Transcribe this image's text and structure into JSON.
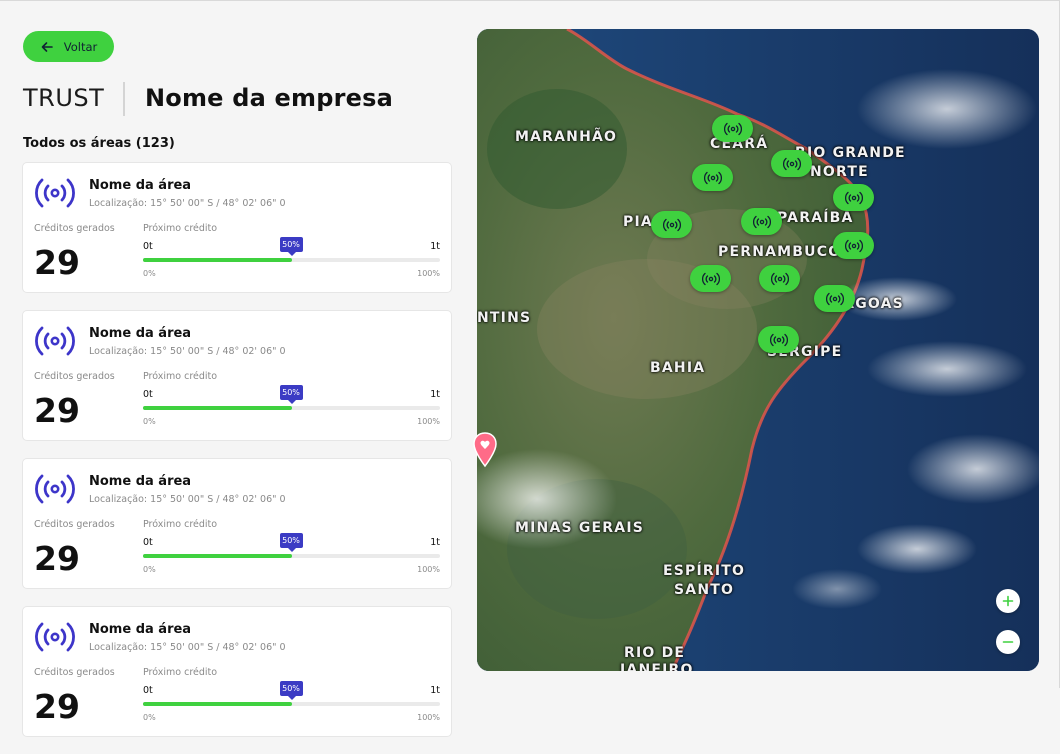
{
  "header": {
    "back_label": "Voltar",
    "brand": "TRUST",
    "company": "Nome da empresa"
  },
  "list": {
    "title": "Todos os áreas (123)"
  },
  "cards": [
    {
      "name": "Nome da área",
      "location": "Localização: 15° 50' 00\" S / 48° 02' 06\" 0",
      "credits_label": "Créditos gerados",
      "credits_value": "29",
      "next_label": "Próximo crédito",
      "t_min": "0t",
      "t_max": "1t",
      "progress": 0.5,
      "badge": "50%",
      "p_min": "0%",
      "p_max": "100%"
    },
    {
      "name": "Nome da área",
      "location": "Localização: 15° 50' 00\" S / 48° 02' 06\" 0",
      "credits_label": "Créditos gerados",
      "credits_value": "29",
      "next_label": "Próximo crédito",
      "t_min": "0t",
      "t_max": "1t",
      "progress": 0.5,
      "badge": "50%",
      "p_min": "0%",
      "p_max": "100%"
    },
    {
      "name": "Nome da área",
      "location": "Localização: 15° 50' 00\" S / 48° 02' 06\" 0",
      "credits_label": "Créditos gerados",
      "credits_value": "29",
      "next_label": "Próximo crédito",
      "t_min": "0t",
      "t_max": "1t",
      "progress": 0.5,
      "badge": "50%",
      "p_min": "0%",
      "p_max": "100%"
    },
    {
      "name": "Nome da área",
      "location": "Localização: 15° 50' 00\" S / 48° 02' 06\" 0",
      "credits_label": "Créditos gerados",
      "credits_value": "29",
      "next_label": "Próximo crédito",
      "t_min": "0t",
      "t_max": "1t",
      "progress": 0.5,
      "badge": "50%",
      "p_min": "0%",
      "p_max": "100%"
    }
  ],
  "map": {
    "labels": {
      "maranhao": "MARANHÃO",
      "ceara": "CEARÁ",
      "rio_grande": "RIO GRANDE",
      "norte": "NORTE",
      "piaui": "PIA",
      "paraiba": "PARAÍBA",
      "pernambuco": "PERNAMBUCO",
      "alagoas": "ALAGOAS",
      "tocantins": "NTINS",
      "bahia": "BAHIA",
      "sergipe": "SERGIPE",
      "minas": "MINAS GERAIS",
      "espirito": "ESPÍRITO",
      "santo": "SANTO",
      "rio": "RIO DE",
      "janeiro": "JANEIRO"
    },
    "marker_icon": "broadcast-icon",
    "zoom_in_icon": "plus-icon",
    "zoom_out_icon": "minus-icon"
  },
  "colors": {
    "accent_green": "#3fd13f",
    "accent_purple": "#3b3bc4",
    "icon_purple": "#3d35c9"
  }
}
